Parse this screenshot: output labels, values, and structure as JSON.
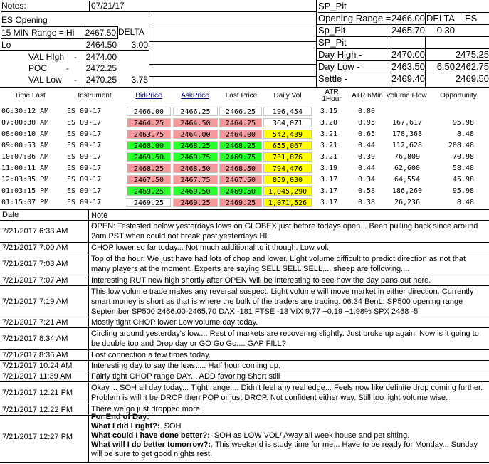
{
  "top_left": {
    "notes_label": "Notes:",
    "date": "07/21/17",
    "es_opening": "ES Opening",
    "range_label": "15 MIN Range = Hi",
    "range_hi": "2467.50",
    "delta_label": "DELTA",
    "lo_label": "Lo",
    "range_lo": "2464.50",
    "delta_value": "3.00",
    "val_high_label": "VAL HIgh",
    "val_high": "2474.00",
    "poc_label": "POC",
    "poc": "2472.25",
    "val_low_label": "VAL Low",
    "val_low": "2470.25",
    "val_low_delta": "3.75",
    "dash": "-"
  },
  "top_right": {
    "sp_pit_1": "SP_Pit",
    "opening_range_label": "Opening Range =",
    "opening_range_value": "2466.00",
    "delta_label": "DELTA",
    "es_label": "ES",
    "sp_pit_2": "Sp_Pit",
    "sp_pit_value": "2465.70",
    "sp_pit_delta": "0.30",
    "sp_pit_3": "SP_Pit",
    "day_high_label": "Day High -",
    "day_high": "2470.00",
    "day_high_es": "2475.25",
    "day_low_label": "Day Low -",
    "day_low": "2463.50",
    "day_low_delta": "6.50",
    "day_low_es": "2462.75",
    "settle_label": "Settle -",
    "settle": "2469.40",
    "settle_es": "2469.50"
  },
  "ticker": {
    "headers": [
      "Time Last",
      "Instrument",
      "BidPrice",
      "AskPrice",
      "Last Price",
      "Daily Vol",
      "ATR 1Hour",
      "ATR 6Min",
      "Volume Flow",
      "Opportunity"
    ],
    "colors": {
      "red": "#f4999b",
      "green": "#2bff2b",
      "yellow": "#ffff00",
      "white": "#ffffff"
    },
    "rows": [
      {
        "time": "06:30:12 AM",
        "inst": "ES 09-17",
        "bid": "2466.00",
        "ask": "2466.25",
        "last": "2466.25",
        "vol": "196,454",
        "atr1": "3.15",
        "atr6": "0.80",
        "flow": "",
        "opp": "",
        "bc": "white",
        "ac": "white",
        "lc": "white",
        "vc": "white"
      },
      {
        "time": "07:00:30 AM",
        "inst": "ES 09-17",
        "bid": "2464.25",
        "ask": "2464.50",
        "last": "2464.25",
        "vol": "364,071",
        "atr1": "3.20",
        "atr6": "0.95",
        "flow": "167,617",
        "opp": "95.98",
        "bc": "red",
        "ac": "red",
        "lc": "red",
        "vc": "white"
      },
      {
        "time": "08:00:10 AM",
        "inst": "ES 09-17",
        "bid": "2463.75",
        "ask": "2464.00",
        "last": "2464.00",
        "vol": "542,439",
        "atr1": "3.21",
        "atr6": "0.65",
        "flow": "178,368",
        "opp": "8.48",
        "bc": "red",
        "ac": "red",
        "lc": "red",
        "vc": "yellow"
      },
      {
        "time": "09:00:53 AM",
        "inst": "ES 09-17",
        "bid": "2468.00",
        "ask": "2468.25",
        "last": "2468.25",
        "vol": "655,067",
        "atr1": "3.21",
        "atr6": "0.44",
        "flow": "112,628",
        "opp": "208.48",
        "bc": "green",
        "ac": "green",
        "lc": "green",
        "vc": "yellow"
      },
      {
        "time": "10:07:06 AM",
        "inst": "ES 09-17",
        "bid": "2469.50",
        "ask": "2469.75",
        "last": "2469.75",
        "vol": "731,876",
        "atr1": "3.21",
        "atr6": "0.39",
        "flow": "76,809",
        "opp": "70.98",
        "bc": "green",
        "ac": "green",
        "lc": "green",
        "vc": "yellow"
      },
      {
        "time": "11:00:11 AM",
        "inst": "ES 09-17",
        "bid": "2468.25",
        "ask": "2468.50",
        "last": "2468.50",
        "vol": "794,476",
        "atr1": "3.19",
        "atr6": "0.44",
        "flow": "62,600",
        "opp": "58.48",
        "bc": "red",
        "ac": "red",
        "lc": "red",
        "vc": "yellow"
      },
      {
        "time": "12:03:35 PM",
        "inst": "ES 09-17",
        "bid": "2467.50",
        "ask": "2467.75",
        "last": "2467.50",
        "vol": "859,030",
        "atr1": "3.17",
        "atr6": "0.34",
        "flow": "64,554",
        "opp": "45.98",
        "bc": "red",
        "ac": "red",
        "lc": "red",
        "vc": "yellow"
      },
      {
        "time": "01:03:15 PM",
        "inst": "ES 09-17",
        "bid": "2469.25",
        "ask": "2469.50",
        "last": "2469.50",
        "vol": "1,045,290",
        "atr1": "3.17",
        "atr6": "0.58",
        "flow": "186,260",
        "opp": "95.98",
        "bc": "green",
        "ac": "green",
        "lc": "green",
        "vc": "yellow"
      },
      {
        "time": "01:15:07 PM",
        "inst": "ES 09-17",
        "bid": "2469.25",
        "ask": "2469.25",
        "last": "2469.25",
        "vol": "1,071,526",
        "atr1": "3.17",
        "atr6": "0.38",
        "flow": "26,236",
        "opp": "8.48",
        "bc": "white",
        "ac": "red",
        "lc": "red",
        "vc": "yellow"
      }
    ]
  },
  "notes": {
    "date_header": "Date",
    "note_header": "Note",
    "rows": [
      {
        "date": "7/21/2017 6:33 AM",
        "text": "OPEN:  Testested below yesterdays lows on GLOBEX just before todays open... Been pulling back since around 2am PST when could not break past yesterdays HI."
      },
      {
        "date": "7/21/2017 7:00 AM",
        "text": "CHOP lower so far today... Not much additional to it though.  Low vol."
      },
      {
        "date": "7/21/2017 7:03 AM",
        "text": "Top of the hour.  We just have had lots of chop and lower.  Light volume difficult to predict direction as not that many players at the moment.  Experts are saying SELL SELL SELL.... sheep are following...."
      },
      {
        "date": "7/21/2017 7:07 AM",
        "text": "Interesting RUT new high shortly after OPEN Will be interesting to see how the day pans out here."
      },
      {
        "date": "7/21/2017 7:19 AM",
        "text": "This low volume trade makes any reversal suspect.  Light volume will move market in either direction.  Currently smart money is short as that is where the bulk of the traders are trading.  06:34 BenL: SP500 opening range September SP500 2466.00-2465.70 DAX -181 FTSE -13 VIX 9.77 +0.19 +1.98% SPX 2468 -5"
      },
      {
        "date": "7/21/2017 7:21 AM",
        "text": "Mostly tight CHOP lower Low volume day today."
      },
      {
        "date": "7/21/2017 8:34 AM",
        "text": "Circling around yesterday's low.... Rest of markets are recovering slightly.  Just broke up again.  Now is it going to be double top and Drop day or GO Go Go.... GAP FILL?"
      },
      {
        "date": "7/21/2017 8:36 AM",
        "text": "Lost connection a few times today."
      },
      {
        "date": "7/21/2017 10:24 AM",
        "text": "Interesting day to say the least.... Half hour coming up."
      },
      {
        "date": "7/21/2017 11:39 AM",
        "text": "Fairly tight CHOP range DAY... ADD favoring Short still"
      },
      {
        "date": "7/21/2017 12:21 PM",
        "text": "Okay.... SOH all day today... Tight range.... Didn't feel any real edge... Feels now like definite drop coming further.  Problem is will it be DROP then POP or just DROP.  Not confident either way.  Still too light volume wise."
      },
      {
        "date": "7/21/2017 12:22 PM",
        "text": "There we go just dropped more."
      }
    ],
    "last": {
      "date": "7/21/2017 12:27 PM",
      "l1": "For End of Day:",
      "q1": "What I did I right?:",
      "a1": ". SOH",
      "q2": "What could I have done better?:",
      "a2": ". SOH as LOW VOL/ Away all week house and pet sitting.",
      "q3": "What will I do better tomorrow?:",
      "a3": ".  This weekend is study time for me... Have to be ready for Monday... Sunday will be sure to get good nights rest."
    }
  }
}
